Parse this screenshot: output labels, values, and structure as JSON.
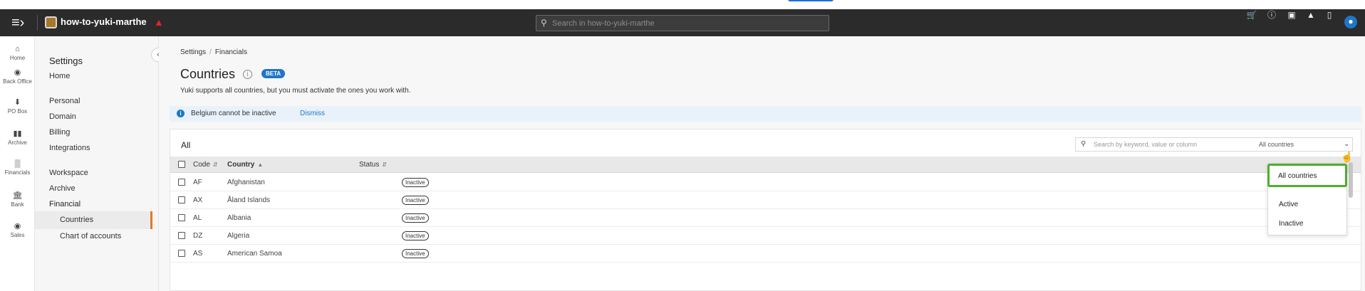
{
  "topbar": {
    "domain": "how-to-yuki-marthe",
    "search_placeholder": "Search in how-to-yuki-marthe",
    "icons": [
      "hamburger-menu-icon",
      "cart-icon",
      "info-icon",
      "gift-icon",
      "megaphone-icon",
      "bookmark-icon",
      "user-icon"
    ]
  },
  "leftnav": {
    "items": [
      {
        "label": "Home",
        "icon": "home-icon"
      },
      {
        "label": "Back Office",
        "icon": "back-office-icon"
      },
      {
        "label": "PO Box",
        "icon": "inbox-icon"
      },
      {
        "label": "Archive",
        "icon": "archive-icon"
      },
      {
        "label": "Financials",
        "icon": "chart-icon"
      },
      {
        "label": "Bank",
        "icon": "bank-icon"
      },
      {
        "label": "Sales",
        "icon": "sales-icon"
      }
    ]
  },
  "settings": {
    "title": "Settings",
    "items": [
      "Home",
      "Personal",
      "Domain",
      "Billing",
      "Integrations",
      "Workspace",
      "Archive",
      "Financial",
      "Countries",
      "Chart of accounts"
    ]
  },
  "breadcrumb": {
    "first": "Settings",
    "second": "Financials"
  },
  "page": {
    "title": "Countries",
    "badge": "BETA",
    "subtitle": "Yuki supports all countries, but you must activate the ones you work with."
  },
  "notice": {
    "text": "Belgium cannot be inactive",
    "action": "Dismiss"
  },
  "table": {
    "title": "All",
    "search_placeholder": "Search by keyword, value or column",
    "filter_value": "All countries",
    "columns": {
      "code": "Code",
      "country": "Country",
      "status": "Status"
    },
    "rows": [
      {
        "code": "AF",
        "country": "Afghanistan",
        "status": "Inactive"
      },
      {
        "code": "AX",
        "country": "Åland Islands",
        "status": "Inactive"
      },
      {
        "code": "AL",
        "country": "Albania",
        "status": "Inactive"
      },
      {
        "code": "DZ",
        "country": "Algeria",
        "status": "Inactive"
      },
      {
        "code": "AS",
        "country": "American Samoa",
        "status": "Inactive"
      }
    ]
  },
  "dropdown": {
    "options": [
      "All countries",
      "Active",
      "Inactive"
    ],
    "selected": "All countries"
  },
  "colors": {
    "topbar": "#2b2b2b",
    "accent": "#e87722",
    "link": "#1f76c7",
    "highlight": "#4caf2a",
    "warning": "#e0242c"
  }
}
